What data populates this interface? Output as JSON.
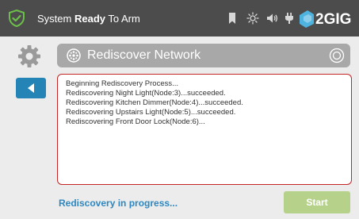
{
  "status_bar": {
    "prefix": "System ",
    "state": "Ready",
    "suffix": " To Arm",
    "icons": [
      "shield-check-icon",
      "bookmark-icon",
      "sun-icon",
      "speaker-icon",
      "plug-icon"
    ],
    "brand": "2GIG"
  },
  "sidebar": {
    "settings_icon": "gear-icon",
    "back_icon": "left-arrow-icon"
  },
  "header": {
    "title": "Rediscover Network",
    "icon": "network-icon"
  },
  "log": {
    "lines": [
      "Beginning Rediscovery Process...",
      "Rediscovering Night Light(Node:3)...succeeded.",
      "Rediscovering Kitchen Dimmer(Node:4)...succeeded.",
      "Rediscovering Upstairs Light(Node:5)...succeeded.",
      "Rediscovering Front Door Lock(Node:6)..."
    ]
  },
  "footer": {
    "progress_text": "Rediscovery in progress...",
    "start_label": "Start"
  },
  "colors": {
    "status_bar": "#4c4c4c",
    "accent_blue": "#2484b6",
    "shield_green": "#6cc04a",
    "start_button": "#b6d28a",
    "log_border": "#c42525"
  }
}
